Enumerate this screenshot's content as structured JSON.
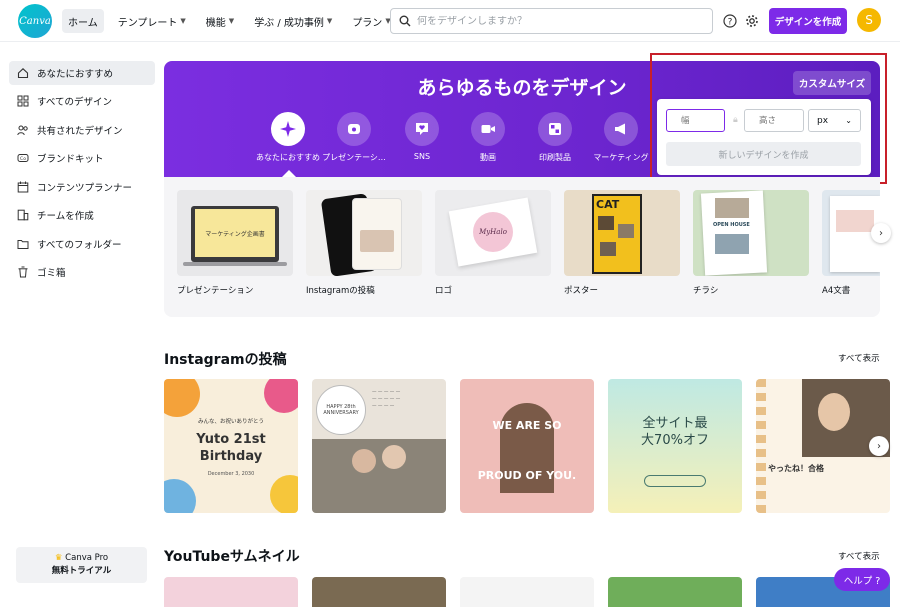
{
  "app": {
    "logo_text": "Canva",
    "brand_color": "#7d2ae8"
  },
  "nav": [
    {
      "label": "ホーム",
      "active": true,
      "dropdown": false
    },
    {
      "label": "テンプレート",
      "active": false,
      "dropdown": true
    },
    {
      "label": "機能",
      "active": false,
      "dropdown": true
    },
    {
      "label": "学ぶ / 成功事例",
      "active": false,
      "dropdown": true
    },
    {
      "label": "プラン",
      "active": false,
      "dropdown": true
    }
  ],
  "search": {
    "placeholder": "何をデザインしますか？"
  },
  "header": {
    "create_label": "デザインを作成",
    "avatar_initial": "S"
  },
  "sidebar": {
    "items": [
      {
        "label": "あなたにおすすめ",
        "icon": "home-icon",
        "active": true
      },
      {
        "label": "すべてのデザイン",
        "icon": "grid-icon",
        "active": false
      },
      {
        "label": "共有されたデザイン",
        "icon": "users-icon",
        "active": false
      },
      {
        "label": "ブランドキット",
        "icon": "brand-kit-icon",
        "active": false
      },
      {
        "label": "コンテンツプランナー",
        "icon": "calendar-icon",
        "active": false
      },
      {
        "label": "チームを作成",
        "icon": "building-icon",
        "active": false
      },
      {
        "label": "すべてのフォルダー",
        "icon": "folder-icon",
        "active": false
      },
      {
        "label": "ゴミ箱",
        "icon": "trash-icon",
        "active": false
      }
    ],
    "pro": {
      "line1": "Canva Pro",
      "line2": "無料トライアル"
    }
  },
  "hero": {
    "title": "あらゆるものをデザイン",
    "categories": [
      {
        "label": "あなたにおすすめ",
        "icon": "sparkle-icon",
        "active": true
      },
      {
        "label": "プレゼンテーシ…",
        "icon": "presentation-icon",
        "active": false
      },
      {
        "label": "SNS",
        "icon": "heart-chat-icon",
        "active": false
      },
      {
        "label": "動画",
        "icon": "video-icon",
        "active": false
      },
      {
        "label": "印刷製品",
        "icon": "print-icon",
        "active": false
      },
      {
        "label": "マーケティング",
        "icon": "megaphone-icon",
        "active": false
      }
    ],
    "custom_size_label": "カスタムサイズ"
  },
  "custom_size": {
    "width_placeholder": "幅",
    "height_placeholder": "高さ",
    "unit": "px",
    "create_label": "新しいデザインを作成"
  },
  "templates": [
    {
      "label": "プレゼンテーション",
      "thumb_text": "マーケティング企画書"
    },
    {
      "label": "Instagramの投稿",
      "thumb_text": ""
    },
    {
      "label": "ロゴ",
      "thumb_text": "MyHalo"
    },
    {
      "label": "ポスター",
      "thumb_text": "CAT"
    },
    {
      "label": "チラシ",
      "thumb_text": "OPEN HOUSE"
    },
    {
      "label": "A4文書",
      "thumb_text": ""
    }
  ],
  "instagram": {
    "title": "Instagramの投稿",
    "see_all": "すべて表示",
    "cards": [
      {
        "top": "みんな、お祝いありがとう",
        "main": "Yuto 21st Birthday",
        "sub": "December 3, 2030"
      },
      {
        "top": "HAPPY 28th ANNIVERSARY",
        "main": "",
        "sub": ""
      },
      {
        "top": "",
        "main": "WE ARE SO PROUD OF YOU.",
        "sub": ""
      },
      {
        "top": "",
        "main": "全サイト最大70%オフ",
        "sub": ""
      },
      {
        "top": "",
        "main": "やったね！合格",
        "sub": ""
      }
    ]
  },
  "youtube": {
    "title": "YouTubeサムネイル",
    "see_all": "すべて表示"
  },
  "help": {
    "label": "ヘルプ ?"
  }
}
